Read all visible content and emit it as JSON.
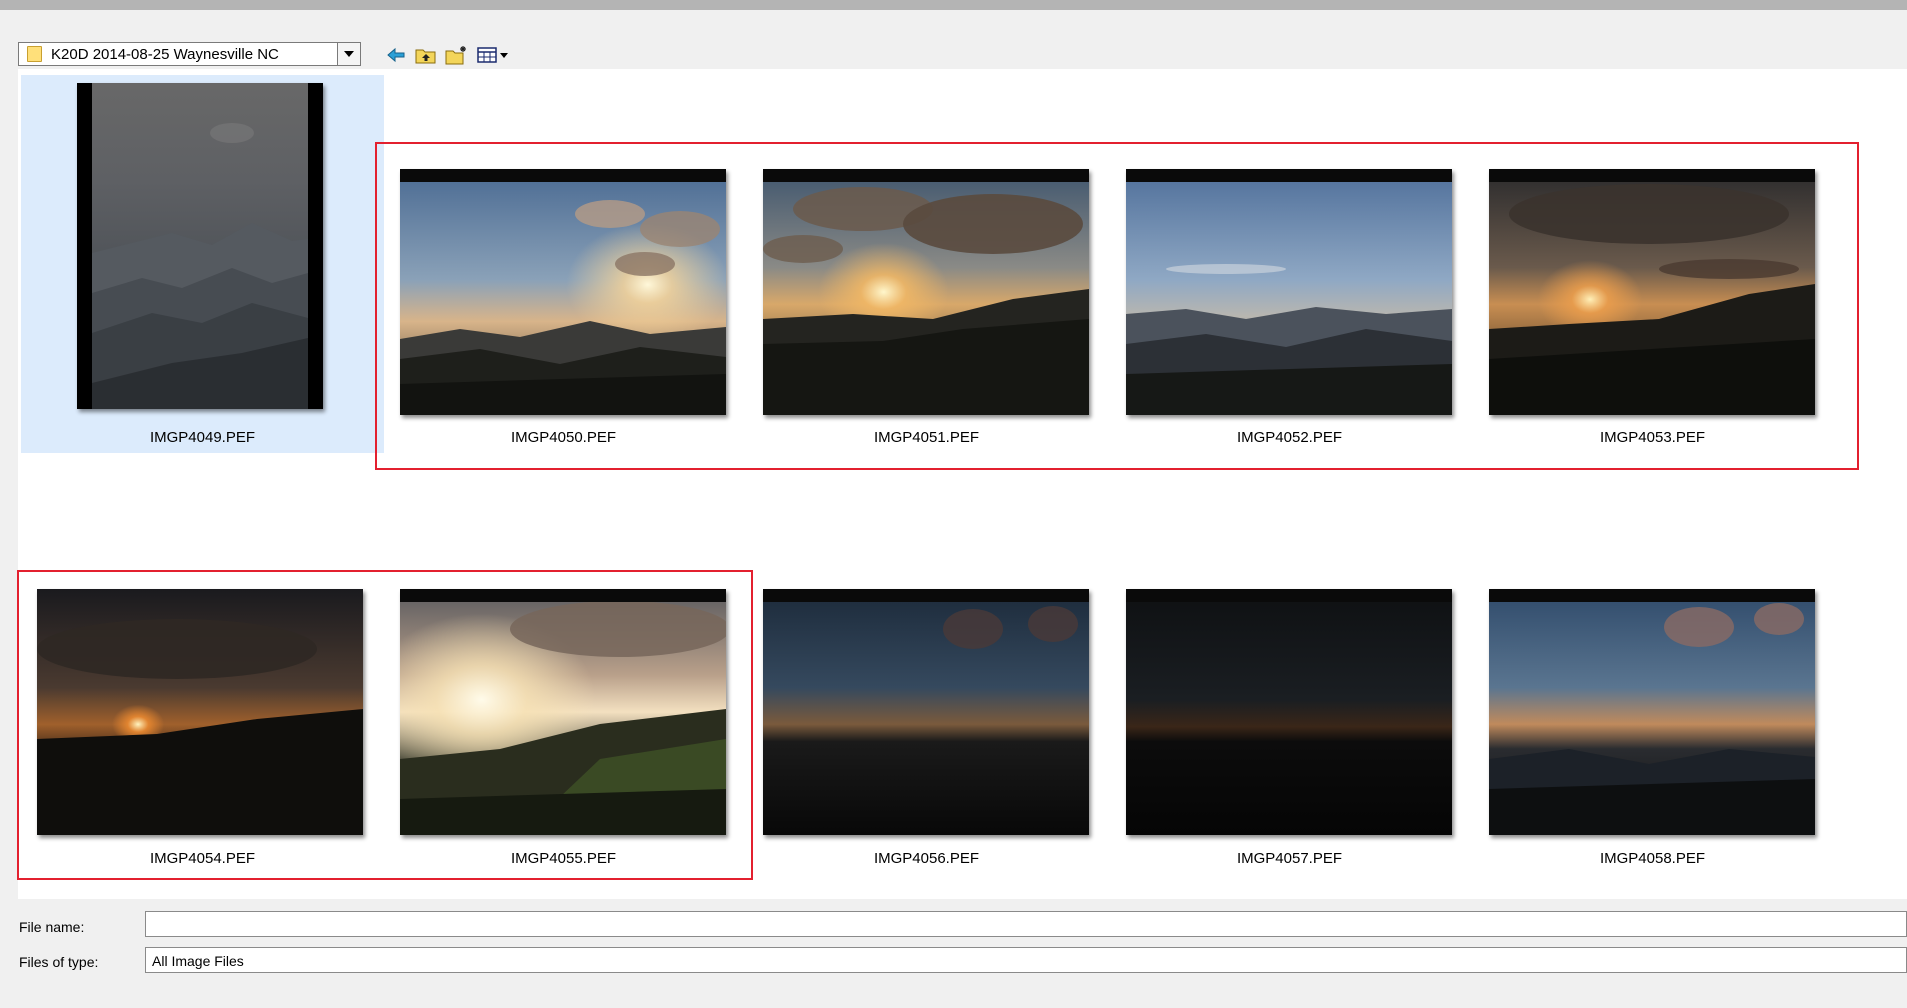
{
  "toolbar": {
    "folder": "K20D 2014-08-25 Waynesville NC",
    "icons": [
      "back-arrow-icon",
      "up-folder-icon",
      "new-folder-icon",
      "view-menu-icon"
    ]
  },
  "files": [
    {
      "name": "IMGP4049.PEF",
      "selected": true
    },
    {
      "name": "IMGP4050.PEF"
    },
    {
      "name": "IMGP4051.PEF"
    },
    {
      "name": "IMGP4052.PEF"
    },
    {
      "name": "IMGP4053.PEF"
    },
    {
      "name": "IMGP4054.PEF"
    },
    {
      "name": "IMGP4055.PEF"
    },
    {
      "name": "IMGP4056.PEF"
    },
    {
      "name": "IMGP4057.PEF"
    },
    {
      "name": "IMGP4058.PEF"
    }
  ],
  "form": {
    "file_name_label": "File name:",
    "file_name_value": "",
    "file_type_label": "Files of type:",
    "file_type_value": "All Image Files"
  },
  "colors": {
    "selection_highlight": "#dcebfc",
    "annotation_frame": "#e3202f"
  }
}
